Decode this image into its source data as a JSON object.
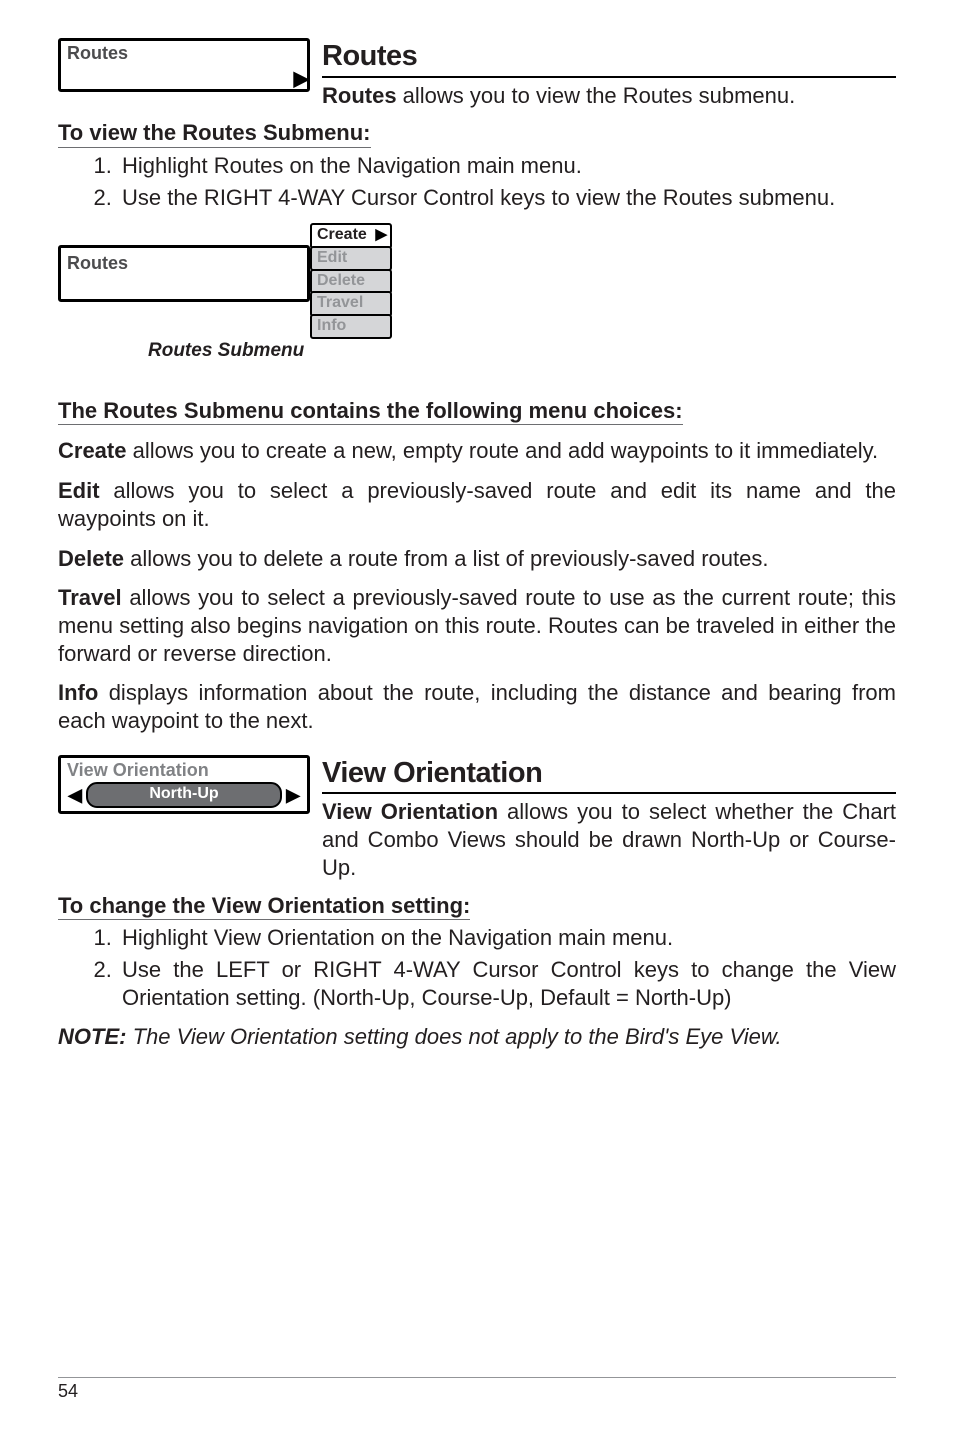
{
  "routes": {
    "menu_label": "Routes",
    "heading": "Routes",
    "intro_bold": "Routes",
    "intro_text": " allows you to view the Routes submenu.",
    "view_header": "To view the Routes Submenu:",
    "steps": [
      "Highlight Routes on the Navigation main menu.",
      "Use the RIGHT 4-WAY Cursor Control keys to view the Routes submenu."
    ],
    "submenu": {
      "main": "Routes",
      "items": [
        "Create",
        "Edit",
        "Delete",
        "Travel",
        "Info"
      ],
      "caption": "Routes Submenu"
    },
    "choices_header": "The Routes Submenu contains the following menu choices:",
    "opts": {
      "create_b": "Create",
      "create_t": " allows you to create a new, empty route and add waypoints to it immediately.",
      "edit_b": "Edit",
      "edit_t": " allows you to select a previously-saved route and edit its name and the waypoints on it.",
      "delete_b": "Delete",
      "delete_t": " allows you to delete a route from a list of previously-saved routes.",
      "travel_b": "Travel",
      "travel_t": " allows you to select a previously-saved route to use as the current route; this menu setting also begins navigation on this route. Routes can be traveled in either the forward or reverse direction.",
      "info_b": "Info",
      "info_t": " displays information about the route, including the distance and bearing from each waypoint to the next."
    }
  },
  "view_orientation": {
    "box_label": "View Orientation",
    "value": "North-Up",
    "heading": "View Orientation",
    "intro_bold": "View Orientation",
    "intro_text": " allows you to select whether the Chart and Combo Views should be drawn North-Up or Course-Up.",
    "change_header": "To change the View Orientation setting:",
    "steps": [
      "Highlight View Orientation on the Navigation main menu.",
      "Use the LEFT or RIGHT 4-WAY Cursor Control keys to change the View Orientation setting. (North-Up, Course-Up, Default = North-Up)"
    ],
    "note_label": "NOTE:",
    "note_text": "  The View Orientation setting does not apply to the Bird's Eye View."
  },
  "page_number": "54"
}
